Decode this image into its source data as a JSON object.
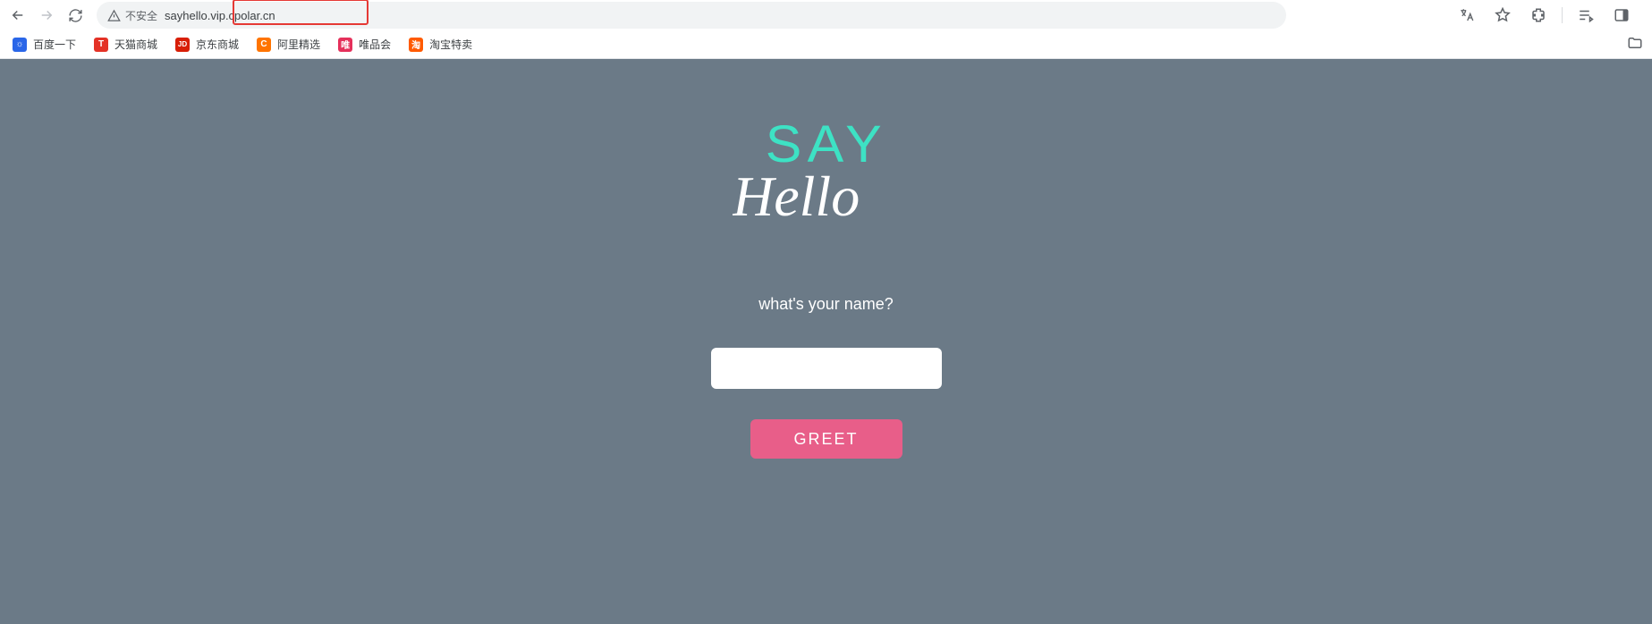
{
  "browser": {
    "security_label": "不安全",
    "url": "sayhello.vip.cpolar.cn"
  },
  "bookmarks": [
    {
      "label": "百度一下",
      "bg": "#2a66e8",
      "glyph": "☼"
    },
    {
      "label": "天猫商城",
      "bg": "#e43226",
      "glyph": "T"
    },
    {
      "label": "京东商城",
      "bg": "#d81e06",
      "glyph": "JD"
    },
    {
      "label": "阿里精选",
      "bg": "#ff7400",
      "glyph": "C"
    },
    {
      "label": "唯品会",
      "bg": "#e5305b",
      "glyph": "唯"
    },
    {
      "label": "淘宝特卖",
      "bg": "#ff5a00",
      "glyph": "淘"
    }
  ],
  "page": {
    "title_top": "SAY",
    "title_bottom": "Hello",
    "prompt": "what's your name?",
    "input_value": "",
    "button_label": "GREET"
  },
  "colors": {
    "page_bg": "#6b7a87",
    "accent_teal": "#3de2c4",
    "button_pink": "#e85e89",
    "highlight_red": "#e53935"
  }
}
